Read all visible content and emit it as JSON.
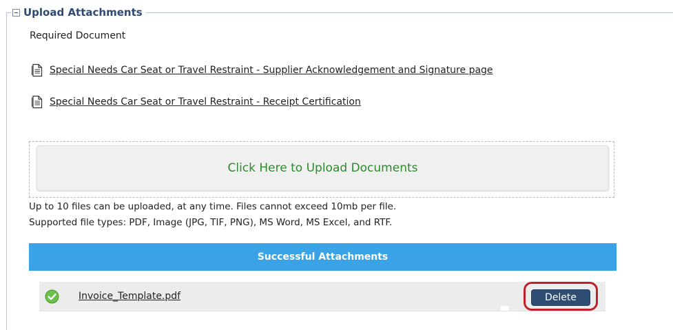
{
  "section": {
    "title": "Upload Attachments",
    "required_label": "Required Document",
    "documents": [
      {
        "label": "Special Needs Car Seat or Travel Restraint - Supplier Acknowledgement and Signature page",
        "icon": "document-icon"
      },
      {
        "label": "Special Needs Car Seat or Travel Restraint - Receipt Certification",
        "icon": "document-icon"
      }
    ]
  },
  "upload": {
    "button_label": "Click Here to Upload Documents",
    "limit_text": "Up to 10 files can be uploaded, at any time. Files cannot exceed 10mb per file.",
    "types_text": "Supported file types: PDF, Image (JPG, TIF, PNG), MS Word, MS Excel, and RTF."
  },
  "attachments": {
    "header": "Successful Attachments",
    "items": [
      {
        "filename": "Invoice_Template.pdf",
        "delete_label": "Delete",
        "status_icon": "check-circle-icon"
      }
    ]
  },
  "colors": {
    "legend_text": "#2e4a73",
    "upload_text": "#2d8a2d",
    "header_bg": "#3aa3e8",
    "delete_bg": "#2f4d73",
    "highlight": "#c0202b"
  }
}
